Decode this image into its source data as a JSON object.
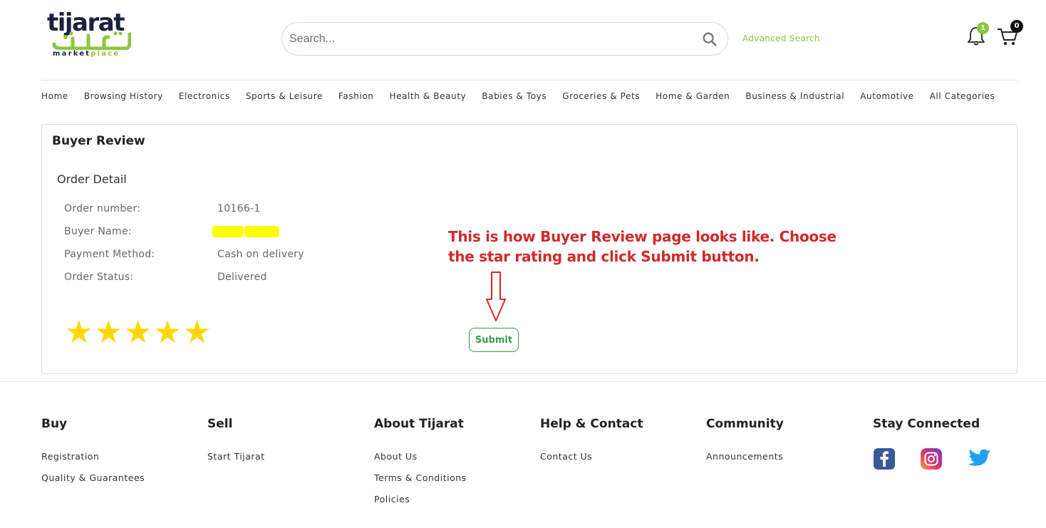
{
  "brand": {
    "name_latin": "tijarat",
    "name_arabic": "تجارت",
    "tagline_prefix": "market",
    "tagline_suffix": "place",
    "colors": {
      "navy": "#1b2240",
      "green": "#8cc63f"
    }
  },
  "search": {
    "placeholder": "Search...",
    "value": "",
    "icon": "search-icon"
  },
  "header": {
    "advanced_search": "Advanced Search",
    "notifications_count": "1",
    "cart_count": "0"
  },
  "nav": {
    "items": [
      {
        "label": "Home"
      },
      {
        "label": "Browsing History"
      },
      {
        "label": "Electronics"
      },
      {
        "label": "Sports & Leisure"
      },
      {
        "label": "Fashion"
      },
      {
        "label": "Health & Beauty"
      },
      {
        "label": "Babies & Toys"
      },
      {
        "label": "Groceries & Pets"
      },
      {
        "label": "Home & Garden"
      },
      {
        "label": "Business & Industrial"
      },
      {
        "label": "Automotive"
      },
      {
        "label": "All Categories"
      }
    ]
  },
  "review": {
    "title": "Buyer Review",
    "section": "Order Detail",
    "fields": [
      {
        "label": "Order number:",
        "value": "10166-1"
      },
      {
        "label": "Buyer Name:",
        "value": ""
      },
      {
        "label": "Payment Method:",
        "value": "Cash on delivery"
      },
      {
        "label": "Order Status:",
        "value": "Delivered"
      }
    ],
    "rating": {
      "stars": 5,
      "max": 5,
      "color": "#ffd700"
    },
    "submit_label": "Submit"
  },
  "annotation": {
    "text": "This is how Buyer Review page looks like. Choose the star rating and click Submit button.",
    "color": "#d02a2a"
  },
  "footer": {
    "columns": [
      {
        "heading": "Buy",
        "links": [
          "Registration",
          "Quality & Guarantees"
        ]
      },
      {
        "heading": "Sell",
        "links": [
          "Start Tijarat"
        ]
      },
      {
        "heading": "About Tijarat",
        "links": [
          "About Us",
          "Terms & Conditions",
          "Policies"
        ]
      },
      {
        "heading": "Help & Contact",
        "links": [
          "Contact Us"
        ]
      },
      {
        "heading": "Community",
        "links": [
          "Announcements"
        ]
      },
      {
        "heading": "Stay Connected",
        "links": []
      }
    ],
    "social": [
      "facebook-icon",
      "instagram-icon",
      "twitter-icon"
    ]
  }
}
